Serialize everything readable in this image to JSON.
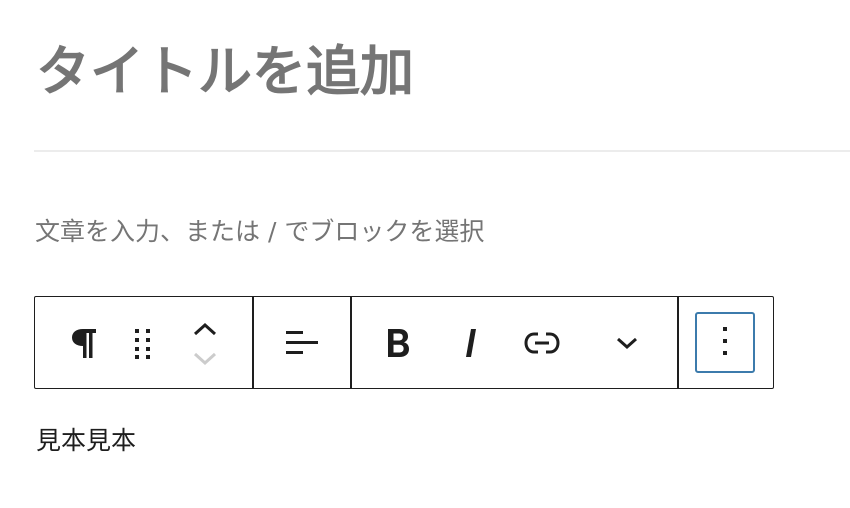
{
  "editor": {
    "title_placeholder": "タイトルを追加",
    "block_placeholder": "文章を入力、または / でブロックを選択",
    "paragraph_text": "見本見本"
  },
  "toolbar": {
    "block_type_icon": "pilcrow-icon",
    "drag_icon": "drag-handle-icon",
    "move_up_icon": "chevron-up-icon",
    "move_down_icon": "chevron-down-icon",
    "align_icon": "align-left-icon",
    "bold_icon": "bold-icon",
    "italic_icon": "italic-icon",
    "link_icon": "link-icon",
    "more_formats_icon": "chevron-down-icon",
    "options_icon": "vertical-ellipsis-icon"
  },
  "colors": {
    "placeholder_gray": "#757575",
    "text": "#1e1e1e",
    "divider": "#ececec",
    "focus_blue": "#3c7bac",
    "disabled_gray": "#cccccc"
  }
}
